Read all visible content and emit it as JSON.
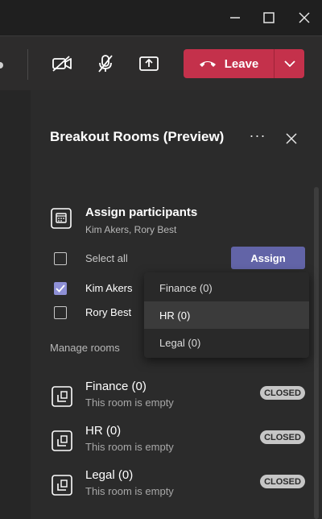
{
  "window": {
    "icons": [
      "minimize-icon",
      "maximize-icon",
      "close-icon"
    ]
  },
  "toolbar": {
    "icons": [
      "camera-off-icon",
      "mic-off-icon",
      "share-screen-icon"
    ],
    "leave_label": "Leave",
    "leave_color": "#c4314b"
  },
  "panel": {
    "title": "Breakout Rooms (Preview)",
    "more_label": "···"
  },
  "assign": {
    "title": "Assign participants",
    "subtitle": "Kim Akers, Rory Best",
    "select_all_label": "Select all",
    "button_label": "Assign",
    "accent": "#6264a7",
    "participants": [
      {
        "name": "Kim Akers",
        "checked": true
      },
      {
        "name": "Rory Best",
        "checked": false
      }
    ]
  },
  "dropdown": {
    "options": [
      "Finance (0)",
      "HR (0)",
      "Legal (0)"
    ],
    "highlighted": "HR (0)"
  },
  "manage": {
    "label": "Manage rooms"
  },
  "rooms": [
    {
      "name": "Finance (0)",
      "status": "This room is empty",
      "badge": "CLOSED"
    },
    {
      "name": "HR (0)",
      "status": "This room is empty",
      "badge": "CLOSED"
    },
    {
      "name": "Legal (0)",
      "status": "This room is empty",
      "badge": "CLOSED"
    }
  ]
}
